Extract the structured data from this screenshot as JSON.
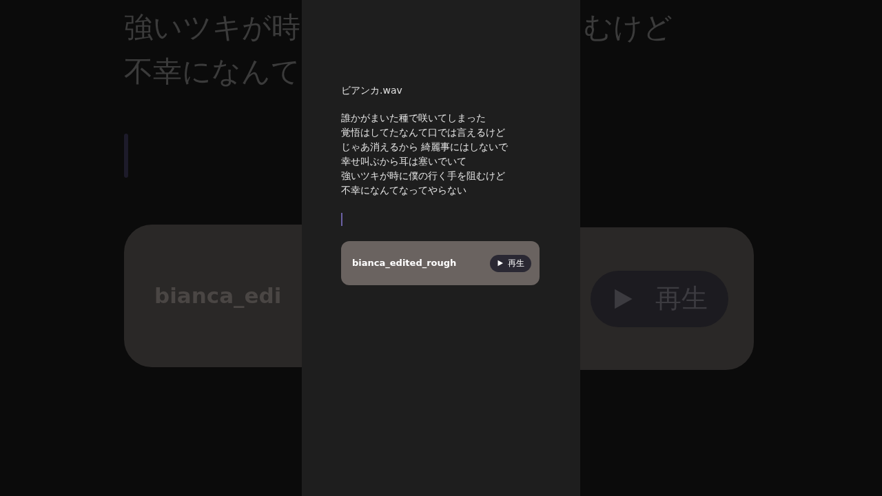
{
  "backdrop": {
    "left_lines": [
      "強いツキが時",
      "不幸になんて"
    ],
    "right_lines": [
      "むけど"
    ],
    "left_card_name": "bianca_edi",
    "right_play_label": "再生"
  },
  "note": {
    "title": "ビアンカ.wav",
    "lyrics": [
      "誰かがまいた種で咲いてしまった",
      "覚悟はしてたなんて口では言えるけど",
      "じゃあ消えるから 綺麗事にはしないで",
      "幸せ叫ぶから耳は塞いでいて",
      "強いツキが時に僕の行く手を阻むけど",
      "不幸になんてなってやらない"
    ],
    "audio": {
      "name": "bianca_edited_rough",
      "play_label": "再生"
    }
  }
}
